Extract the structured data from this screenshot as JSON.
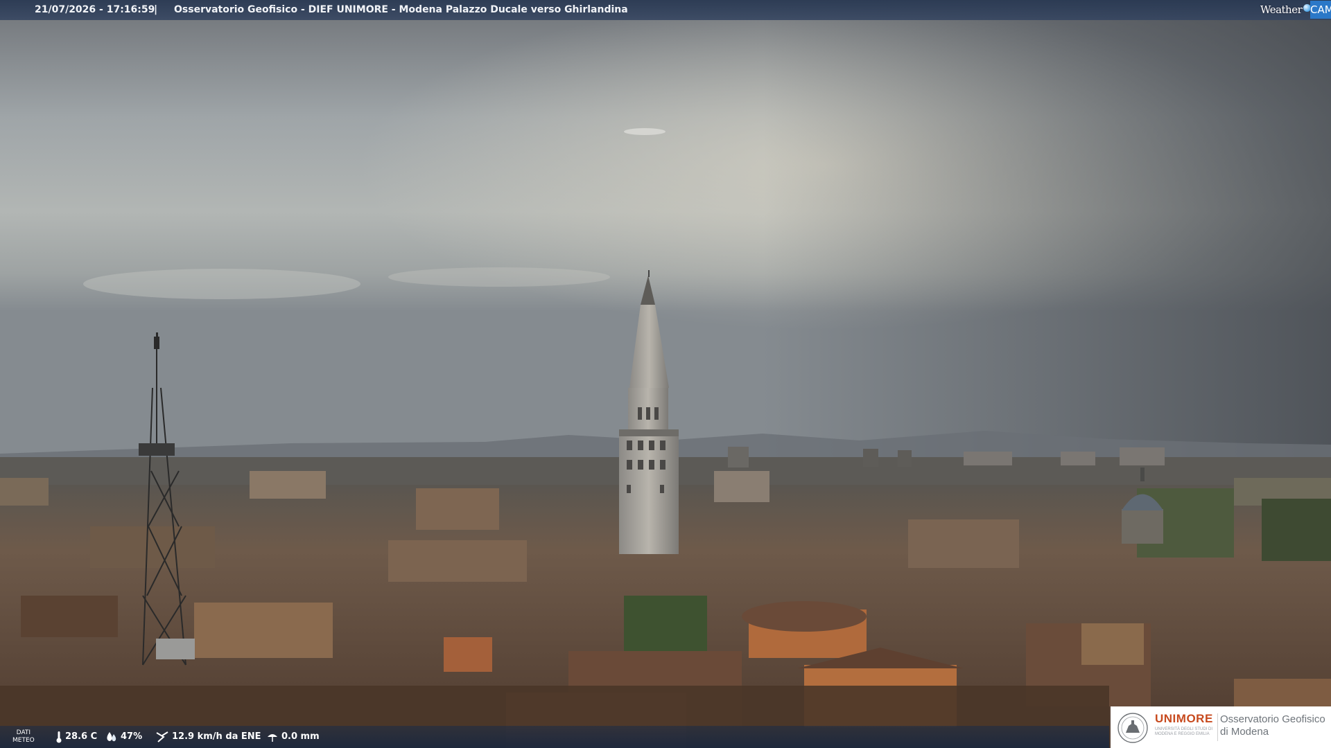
{
  "overlay": {
    "timestamp": "21/07/2026 - 17:16:59",
    "separator": "|",
    "camera_title": "Osservatorio Geofisico - DIEF UNIMORE - Modena Palazzo Ducale verso Ghirlandina",
    "brand_weather": "Weather",
    "brand_cam": "CAM"
  },
  "weather": {
    "label_line1": "DATI",
    "label_line2": "METEO",
    "temperature": "28.6 C",
    "humidity": "47%",
    "wind": "12.9 km/h da ENE",
    "rain": "0.0 mm",
    "icons": [
      "thermometer-icon",
      "humidity-icon",
      "wind-icon",
      "rain-gauge-icon"
    ]
  },
  "logo": {
    "uni_bold": "UNIMORE",
    "uni_prefix": "UNI",
    "uni_suffix": "MORE",
    "uni_sub_line1": "UNIVERSITÀ DEGLI STUDI DI",
    "uni_sub_line2": "MODENA E REGGIO EMILIA",
    "observatory_line1": "Osservatorio Geofisico",
    "observatory_line2": "di Modena"
  },
  "colors": {
    "bar_blue": "#283852",
    "brand_blue": "#2b78c8",
    "unimore_orange": "#c74a1e"
  }
}
